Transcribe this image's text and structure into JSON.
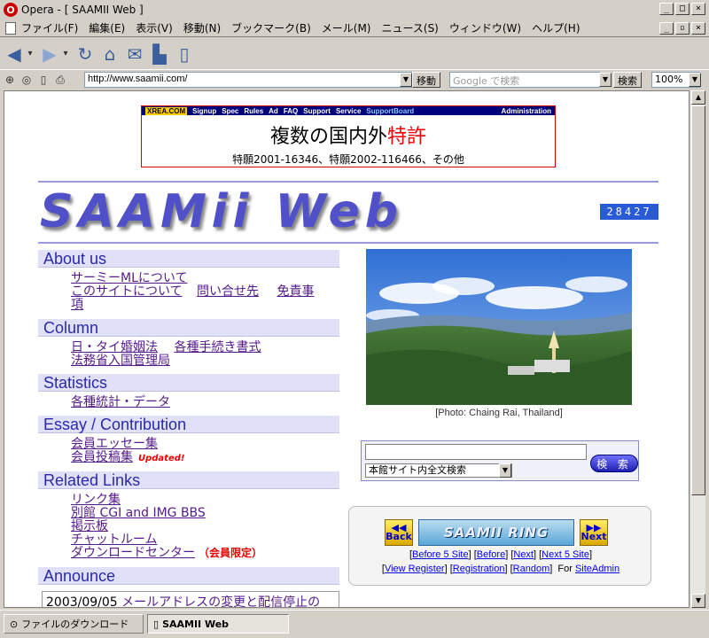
{
  "window": {
    "title": "Opera - [ SAAMII Web ]"
  },
  "menu": [
    "ファイル(F)",
    "編集(E)",
    "表示(V)",
    "移動(N)",
    "ブックマーク(B)",
    "メール(M)",
    "ニュース(S)",
    "ウィンドウ(W)",
    "ヘルプ(H)"
  ],
  "toolbar": {
    "go_label": "移動",
    "search_placeholder": "Google で検索",
    "search_label": "検索",
    "zoom": "100%"
  },
  "address": {
    "url": "http://www.saamii.com/"
  },
  "banner": {
    "links": [
      "XREA.COM",
      "Signup",
      "Spec",
      "Rules",
      "Ad",
      "FAQ",
      "Support",
      "Service",
      "SupportBoard"
    ],
    "admin": "Administration",
    "headline_black": "複数の国内外",
    "headline_red": "特許",
    "subline": "特願2001-16346、特願2002-116466、その他"
  },
  "site": {
    "logo": "SAAMii Web",
    "counter": "28427"
  },
  "sections": {
    "about": {
      "title": "About us",
      "l1": "サーミーMLについて",
      "l2": "このサイトについて",
      "l3": "問い合せ先",
      "l4a": "免責事",
      "l4b": "項"
    },
    "column": {
      "title": "Column",
      "l1": "日・タイ婚姻法",
      "l2": "各種手続き書式",
      "l3": "法務省入国管理局"
    },
    "stats": {
      "title": "Statistics",
      "l1": "各種統計・データ"
    },
    "essay": {
      "title": "Essay / Contribution",
      "l1": "会員エッセー集",
      "l2": "会員投稿集",
      "updated": "Updated!"
    },
    "related": {
      "title": "Related Links",
      "l1": "リンク集",
      "l2": "別館 CGI and IMG BBS",
      "l3": "掲示板",
      "l4": "チャットルーム",
      "l5": "ダウンロードセンター",
      "member": "（会員限定）"
    },
    "announce": {
      "title": "Announce",
      "date": "2003/09/05",
      "text": "メールアドレスの変更と配信停止の"
    }
  },
  "photo": {
    "caption": "[Photo: Chaing Rai, Thailand]"
  },
  "sitesearch": {
    "scope": "本館サイト内全文検索",
    "button": "検 索"
  },
  "ring": {
    "back": "Back",
    "next": "Next",
    "logo": "SAAMII RING",
    "before5": "Before 5 Site",
    "before": "Before",
    "nextl": "Next",
    "next5": "Next 5 Site",
    "view": "View Register",
    "reg": "Registration",
    "random": "Random",
    "for_label": "For",
    "admin": "SiteAdmin"
  },
  "statusbar": {
    "download": "ファイルのダウンロード",
    "tab": "SAAMII Web"
  }
}
